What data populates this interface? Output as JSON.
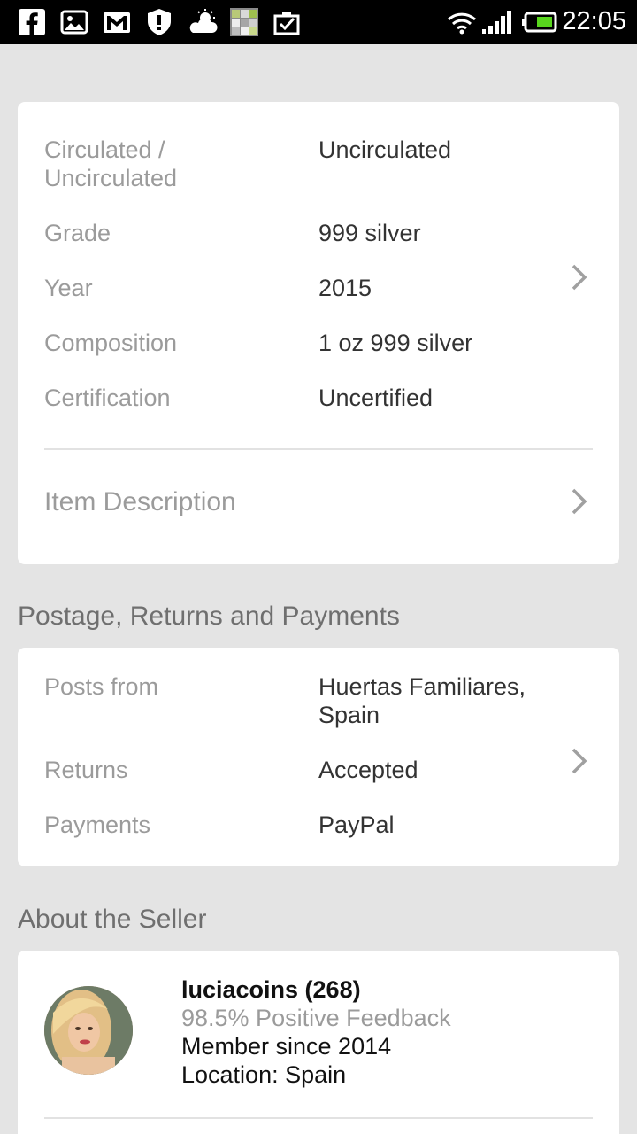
{
  "status_bar": {
    "time": "22:05",
    "left_icons": [
      "facebook-icon",
      "gallery-icon",
      "gmail-icon",
      "shield-icon",
      "weather-icon",
      "app-icon",
      "clipboard-check-icon"
    ],
    "right_icons": [
      "wifi-icon",
      "signal-icon",
      "battery-icon"
    ]
  },
  "item_specifics": {
    "rows": [
      {
        "label": "Circulated / Uncirculated",
        "value": "Uncirculated"
      },
      {
        "label": "Grade",
        "value": "999 silver"
      },
      {
        "label": "Year",
        "value": "2015"
      },
      {
        "label": "Composition",
        "value": "1 oz 999 silver"
      },
      {
        "label": "Certification",
        "value": "Uncertified"
      }
    ],
    "item_description_label": "Item Description"
  },
  "postage": {
    "section_title": "Postage, Returns and Payments",
    "rows": [
      {
        "label": "Posts from",
        "value": "Huertas Familiares, Spain"
      },
      {
        "label": "Returns",
        "value": "Accepted"
      },
      {
        "label": "Payments",
        "value": "PayPal"
      }
    ]
  },
  "seller": {
    "section_title": "About the Seller",
    "name": "luciacoins (268)",
    "feedback": "98.5% Positive Feedback",
    "member_since": "Member since 2014",
    "location": "Location: Spain"
  },
  "colors": {
    "background": "#e4e4e4",
    "label_gray": "#9b9b9b",
    "value_dark": "#333333",
    "divider": "#e2e2e2"
  }
}
